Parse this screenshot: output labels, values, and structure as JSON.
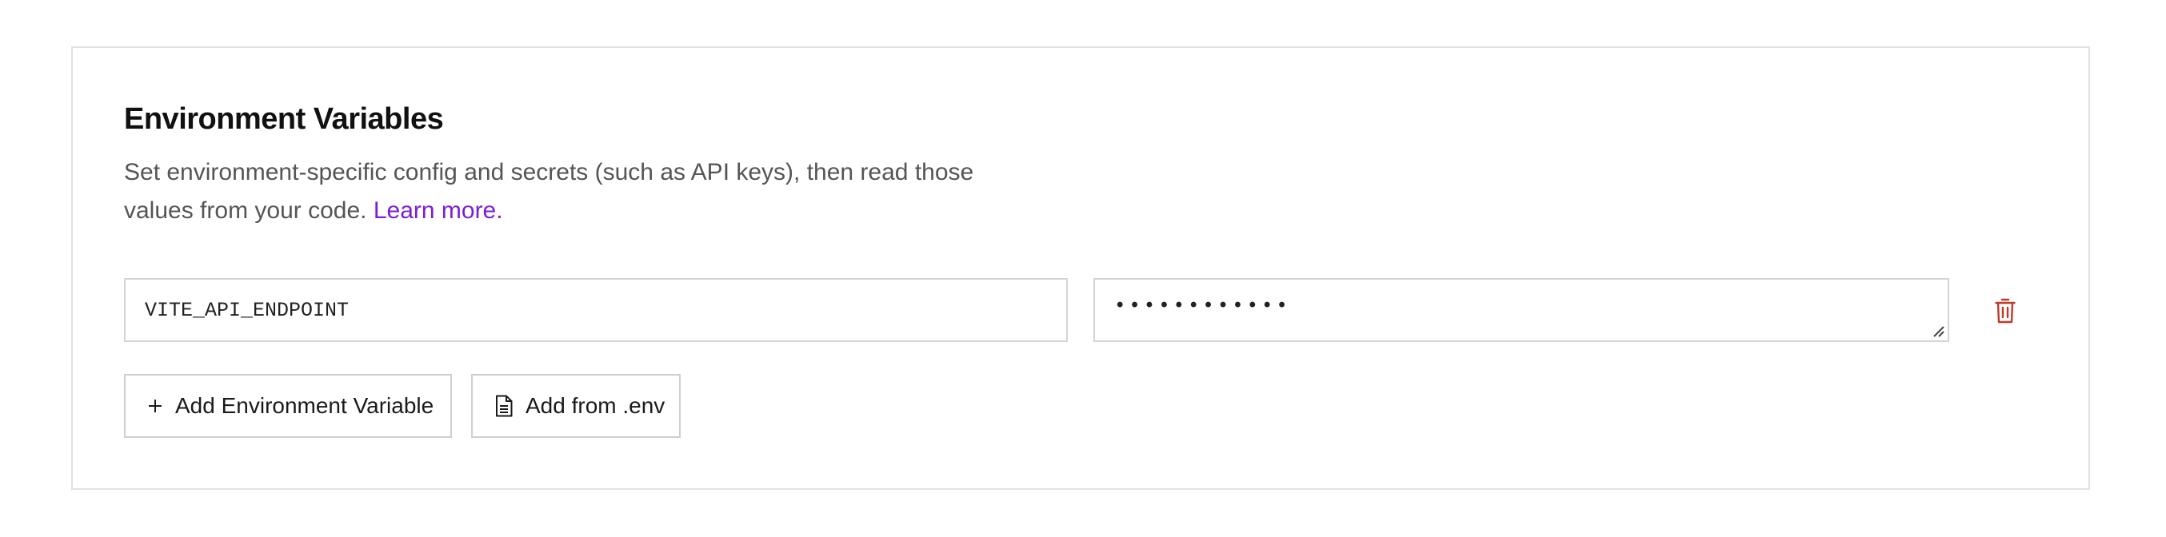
{
  "section": {
    "title": "Environment Variables",
    "description": "Set environment-specific config and secrets (such as API keys), then read those values from your code.",
    "learn_more": "Learn more."
  },
  "variables": [
    {
      "key": "VITE_API_ENDPOINT",
      "value_masked": "••••••••••••"
    }
  ],
  "actions": {
    "add_variable_label": "Add Environment Variable",
    "add_variable_icon": "plus-icon",
    "add_from_env_label": "Add from .env",
    "add_from_env_icon": "document-icon",
    "delete_icon": "trash-icon"
  },
  "colors": {
    "link": "#7a1fd6",
    "delete": "#c0392b",
    "border": "#d4d4d4"
  }
}
